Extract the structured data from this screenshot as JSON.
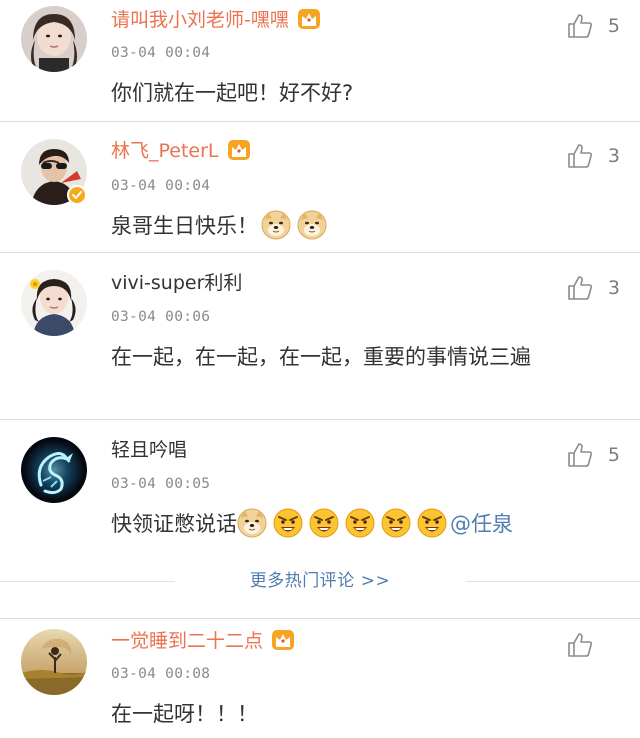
{
  "comments": [
    {
      "username": "请叫我小刘老师-嘿嘿",
      "timestamp": "03-04 00:04",
      "content": "你们就在一起吧！好不好?",
      "likes": "5",
      "vip": true,
      "verified": false
    },
    {
      "username": "林飞_PeterL",
      "timestamp": "03-04 00:04",
      "content": "泉哥生日快乐！",
      "emojis": [
        "doge-emoji",
        "doge-emoji"
      ],
      "likes": "3",
      "vip": true,
      "verified": true
    },
    {
      "username": "vivi-super利利",
      "timestamp": "03-04 00:06",
      "content": "在一起，在一起，在一起，重要的事情说三遍",
      "likes": "3",
      "vip": false,
      "verified": false
    },
    {
      "username": "轻且吟唱",
      "timestamp": "03-04 00:05",
      "content": "快领证憋说话",
      "emojis": [
        "doge-emoji",
        "angry-emoji",
        "angry-emoji",
        "angry-emoji",
        "angry-emoji",
        "angry-emoji"
      ],
      "mention": "@任泉",
      "likes": "5",
      "vip": false,
      "verified": false
    },
    {
      "username": "一觉睡到二十二点",
      "timestamp": "03-04 00:08",
      "content": "在一起呀！！！",
      "likes": "",
      "vip": true,
      "verified": false
    }
  ],
  "more_hot_comments": "更多热门评论 >>",
  "colors": {
    "vip_username": "#eb7350",
    "normal_username": "#333333",
    "link": "#507daf",
    "timestamp": "#8a8a8a",
    "divider": "#dcdcdc"
  }
}
